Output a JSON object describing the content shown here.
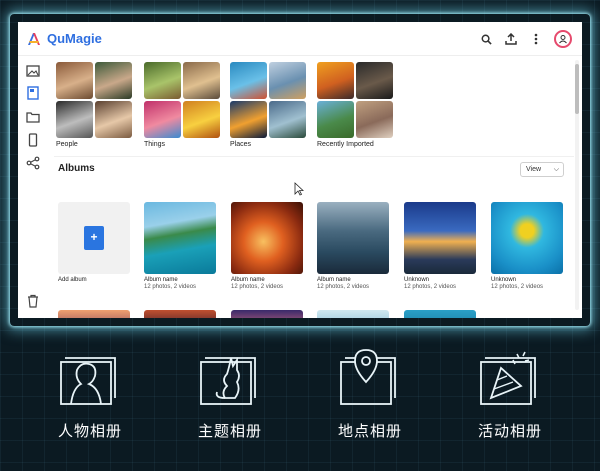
{
  "app": {
    "name": "QuMagie"
  },
  "header": {
    "icons": [
      "search-icon",
      "upload-icon",
      "more-icon",
      "account-icon"
    ]
  },
  "sidebar": {
    "icons": [
      "photos-icon",
      "album-icon",
      "folder-icon",
      "phone-icon",
      "share-icon",
      "trash-icon"
    ]
  },
  "categories": [
    {
      "label": "People"
    },
    {
      "label": "Things"
    },
    {
      "label": "Places"
    },
    {
      "label": "Recently Imported"
    }
  ],
  "albums_section": {
    "title": "Albums",
    "view_label": "View"
  },
  "add_album": {
    "label": "Add album"
  },
  "albums": [
    {
      "name": "Album name",
      "info": "12 photos, 2 videos"
    },
    {
      "name": "Album name",
      "info": "12 photos, 2 videos"
    },
    {
      "name": "Album name",
      "info": "12 photos, 2 videos"
    },
    {
      "name": "Unknown",
      "info": "12 photos, 2 videos"
    },
    {
      "name": "Unknown",
      "info": "12 photos, 2 videos"
    }
  ],
  "features": [
    {
      "label": "人物相册",
      "icon": "person-album-icon"
    },
    {
      "label": "主题相册",
      "icon": "theme-album-icon"
    },
    {
      "label": "地点相册",
      "icon": "location-album-icon"
    },
    {
      "label": "活动相册",
      "icon": "event-album-icon"
    }
  ],
  "colors": {
    "accent": "#2f6fe0",
    "glow": "#78e6ff",
    "background": "#0b1a22"
  }
}
